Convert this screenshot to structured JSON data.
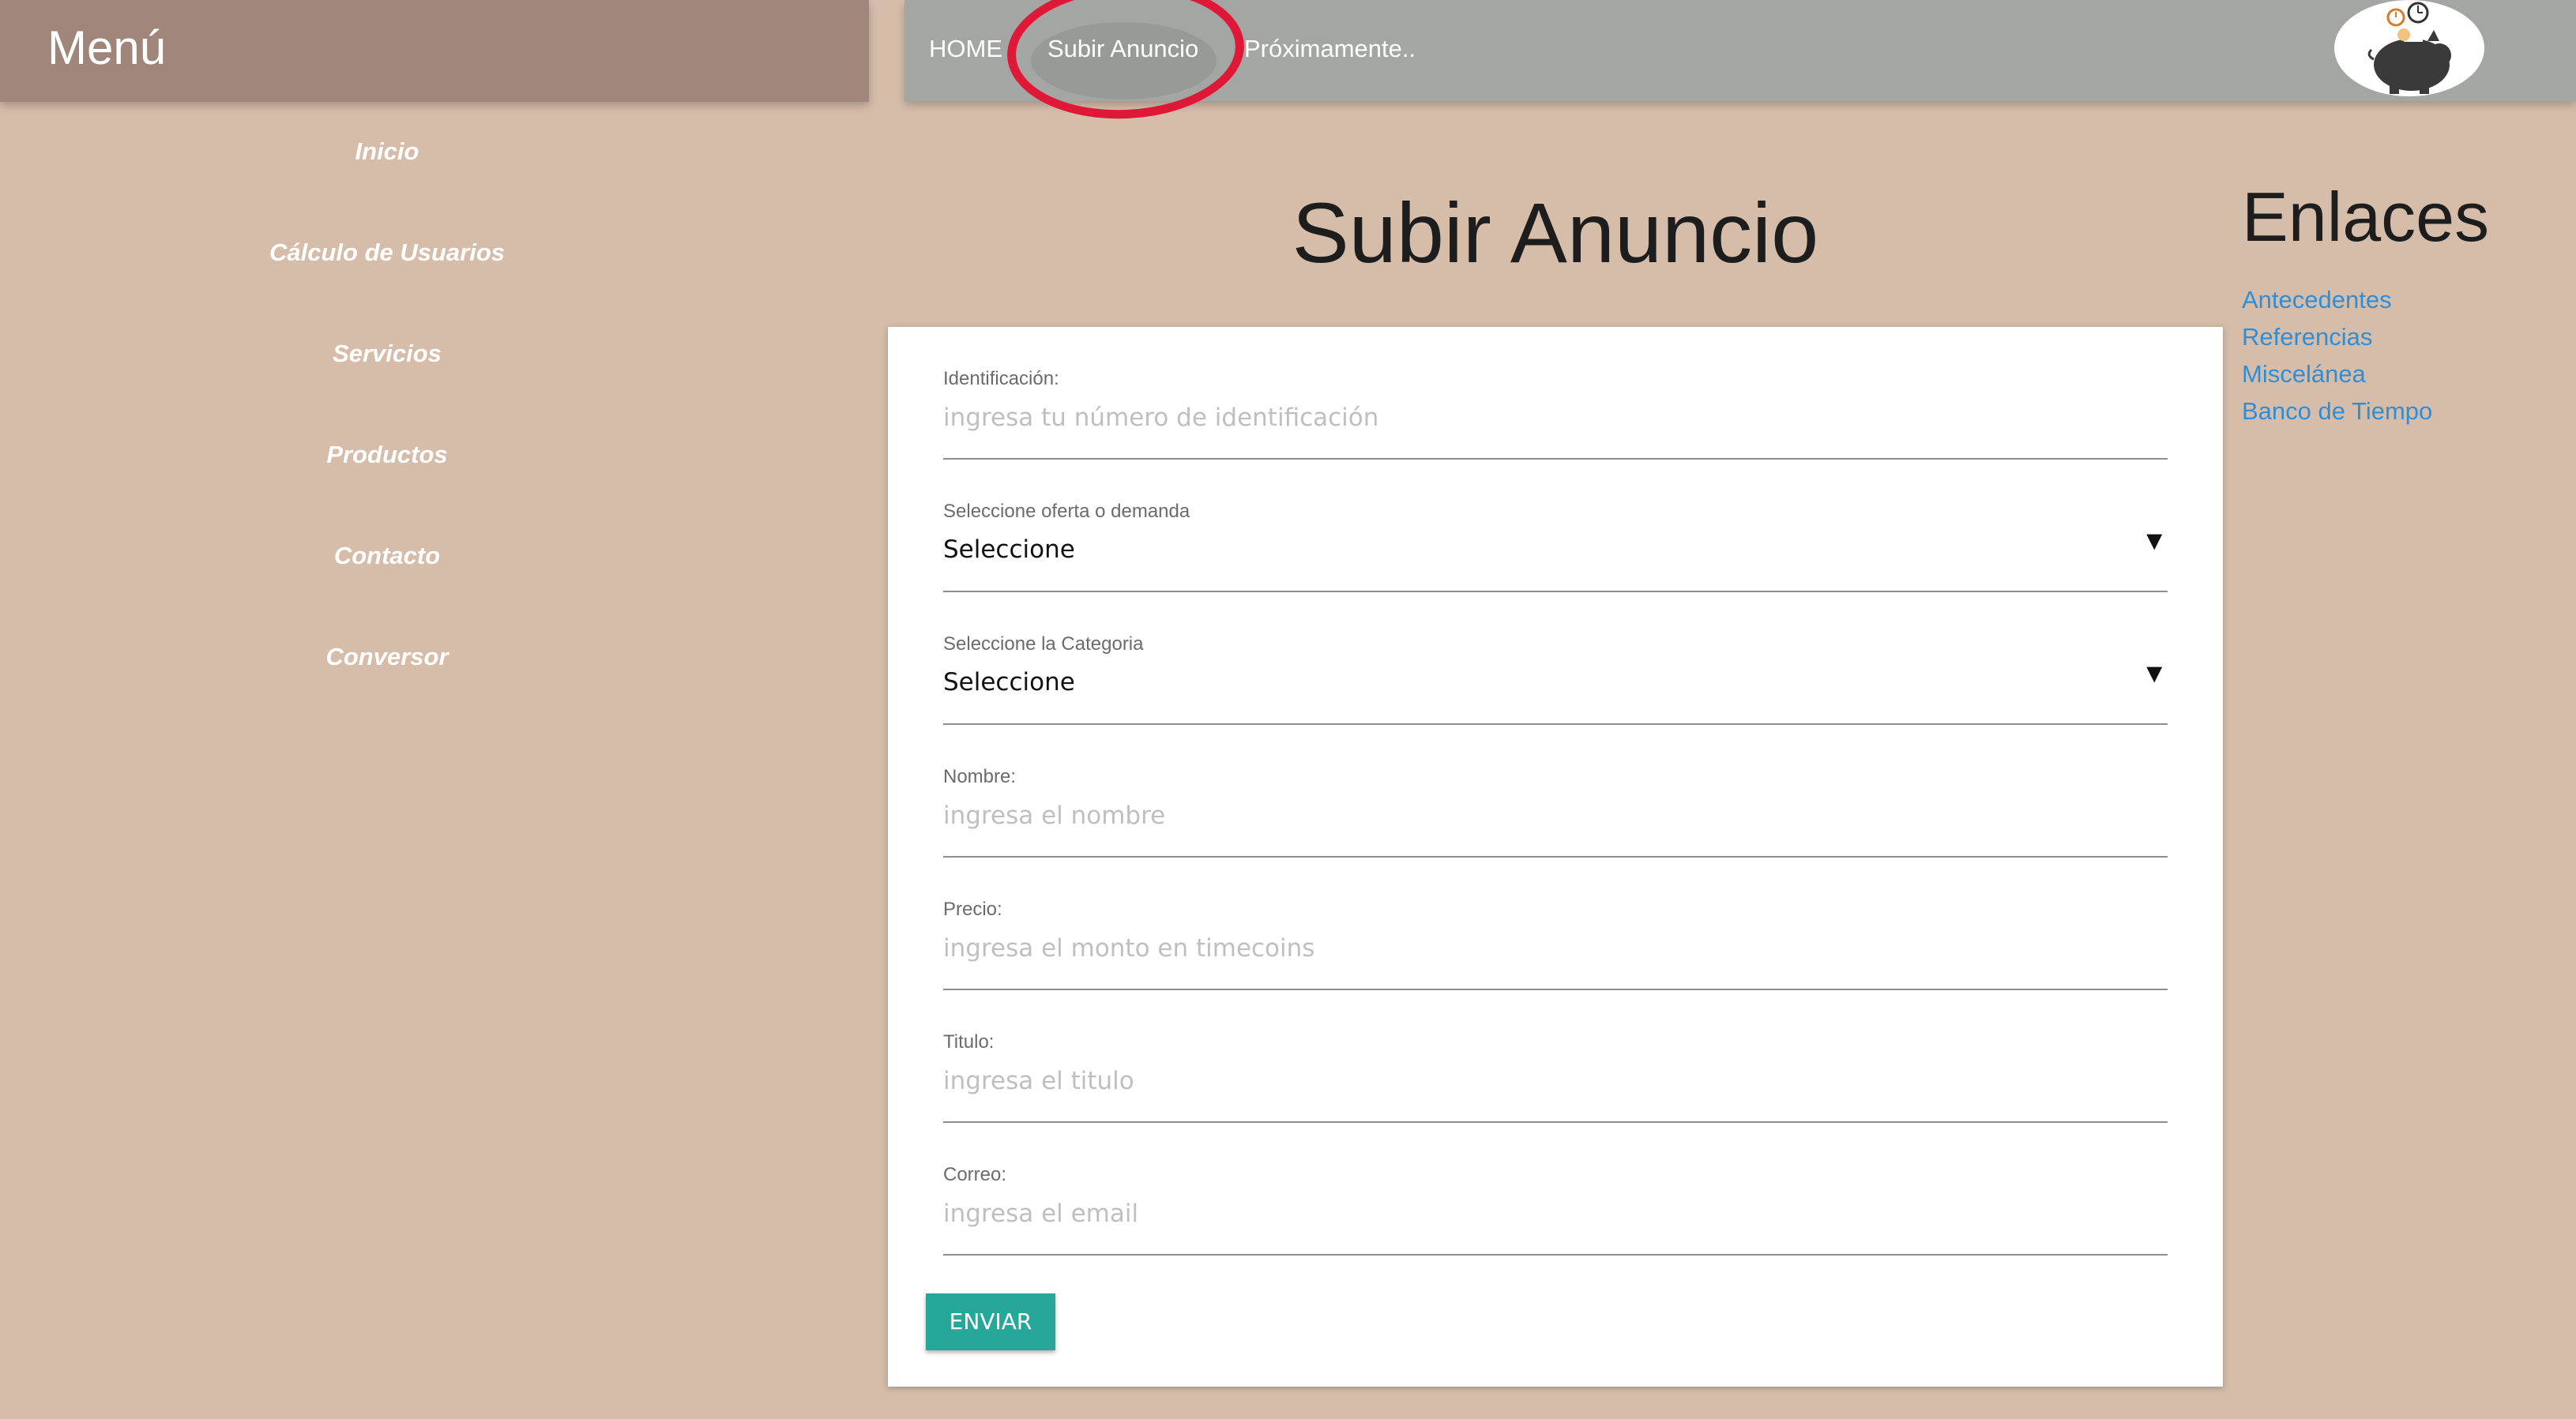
{
  "sidebar": {
    "title": "Menú",
    "items": [
      "Inicio",
      "Cálculo de Usuarios",
      "Servicios",
      "Productos",
      "Contacto",
      "Conversor"
    ]
  },
  "topnav": {
    "home": "HOME",
    "upload": "Subir Anuncio",
    "soon": "Próximamente.."
  },
  "page": {
    "title": "Subir Anuncio"
  },
  "form": {
    "id": {
      "label": "Identificación:",
      "placeholder": "ingresa tu número de identificación"
    },
    "type": {
      "label": "Seleccione oferta o demanda",
      "value": "Seleccione"
    },
    "category": {
      "label": "Seleccione la Categoria",
      "value": "Seleccione"
    },
    "name": {
      "label": "Nombre:",
      "placeholder": "ingresa el nombre"
    },
    "price": {
      "label": "Precio:",
      "placeholder": "ingresa el monto en timecoins"
    },
    "title": {
      "label": "Titulo:",
      "placeholder": "ingresa el titulo"
    },
    "email": {
      "label": "Correo:",
      "placeholder": "ingresa el email"
    },
    "submit": "ENVIAR",
    "arrow": "▼"
  },
  "links": {
    "title": "Enlaces",
    "items": [
      "Antecedentes",
      "Referencias",
      "Miscelánea",
      "Banco de Tiempo"
    ]
  },
  "colors": {
    "background": "#d5bdaa",
    "menu": "#a0857b",
    "topbar": "#a4a6a4",
    "accent": "#27a69a",
    "link": "#2f8ed8",
    "highlight": "#e01838"
  },
  "icons": {
    "logo": "piggy-bank-clock-logo"
  }
}
